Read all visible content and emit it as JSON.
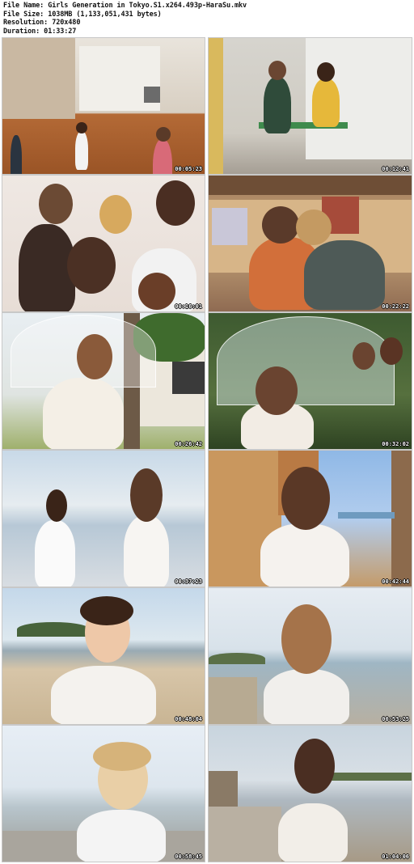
{
  "info": {
    "file_name": "File Name: Girls Generation in Tokyo.S1.x264.493p-HaraSu.mkv",
    "file_size": "File Size: 1038MB (1,133,051,431 bytes)",
    "resolution": "Resolution: 720x480",
    "duration": "Duration: 01:33:27"
  },
  "thumbnails": [
    {
      "timestamp": "00:05:23"
    },
    {
      "timestamp": "00:12:41"
    },
    {
      "timestamp": "00:16:01"
    },
    {
      "timestamp": "00:22:22"
    },
    {
      "timestamp": "00:26:42"
    },
    {
      "timestamp": "00:32:02"
    },
    {
      "timestamp": "00:37:23"
    },
    {
      "timestamp": "00:42:44"
    },
    {
      "timestamp": "00:48:04"
    },
    {
      "timestamp": "00:53:25"
    },
    {
      "timestamp": "00:58:45"
    },
    {
      "timestamp": "01:04:06"
    }
  ]
}
